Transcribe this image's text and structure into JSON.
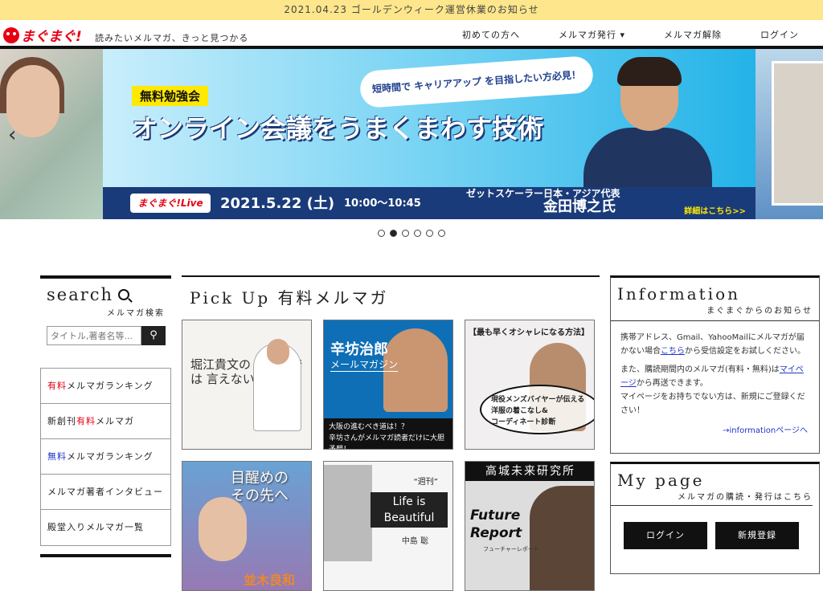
{
  "notice": "2021.04.23 ゴールデンウィーク運営休業のお知らせ",
  "header": {
    "logo": "まぐまぐ!",
    "tagline": "読みたいメルマガ、きっと見つかる",
    "nav": [
      "初めての方へ",
      "メルマガ発行 ▾",
      "メルマガ解除",
      "ログイン"
    ]
  },
  "banner": {
    "tag": "無料勉強会",
    "pill": "短時間で キャリアアップ を目指したい方必見！",
    "headline": "オンライン会議をうまくまわす技術",
    "live_badge": "まぐまぐ!Live",
    "date": "2021.5.22 (土)",
    "time": "10:00〜10:45",
    "speaker_title": "ゼットスケーラー日本・アジア代表",
    "speaker_name": "金田博之氏",
    "details": "詳細はこちら>>",
    "slide_count": 6,
    "active_slide": 2
  },
  "search": {
    "title": "search",
    "subtitle": "メルマガ検索",
    "placeholder": "タイトル,著者名等...",
    "button_icon": "search-icon"
  },
  "ranking": [
    {
      "prefix": "有料",
      "text": "メルマガランキング",
      "color": "red"
    },
    {
      "prefix": "新創刊",
      "highlight": "有料",
      "text": "メルマガ",
      "color": "red"
    },
    {
      "prefix": "無料",
      "text": "メルマガランキング",
      "color": "blue"
    },
    {
      "text": "メルマガ著者インタビュー"
    },
    {
      "text": "殿堂入りメルマガ一覧"
    }
  ],
  "pickup": {
    "title": "Pick Up 有料メルマガ",
    "cards": [
      {
        "title": "堀江貴文の ブログでは 言えない話"
      },
      {
        "title": "辛坊治郎",
        "sub": "メールマガジン",
        "caption1": "大阪の進むべき道は！？",
        "caption2": "辛坊さんがメルマガ読者だけに大胆予想！"
      },
      {
        "title": "【最も早くオシャレになる方法】",
        "bubble1": "現役メンズバイヤーが伝える",
        "bubble2": "洋服の着こなし&",
        "bubble3": "コーディネート診断"
      },
      {
        "title1": "目醒めの",
        "title2": "その先へ",
        "name": "並木良和"
      },
      {
        "weekly": "“週刊”",
        "life1": "Life is",
        "life2": "Beautiful",
        "name": "中島 聡"
      },
      {
        "title": "高城未来研究所",
        "fut1": "Future",
        "fut2": "Report",
        "sub": "フューチャーレポート"
      }
    ]
  },
  "information": {
    "title": "Information",
    "subtitle": "まぐまぐからのお知らせ",
    "p1a": "携帯アドレス、Gmail、YahooMailにメルマガが届かない場合",
    "p1link": "こちら",
    "p1b": "から受信設定をお試しください。",
    "p2a": "また、購読期間内のメルマガ(有料・無料)は",
    "p2link": "マイページ",
    "p2b": "から再送できます。",
    "p3": "マイページをお持ちでない方は、新規にご登録ください！",
    "more": "→informationページへ"
  },
  "mypage": {
    "title": "My page",
    "subtitle": "メルマガの購読・発行はこちら",
    "login": "ログイン",
    "signup": "新規登録"
  }
}
